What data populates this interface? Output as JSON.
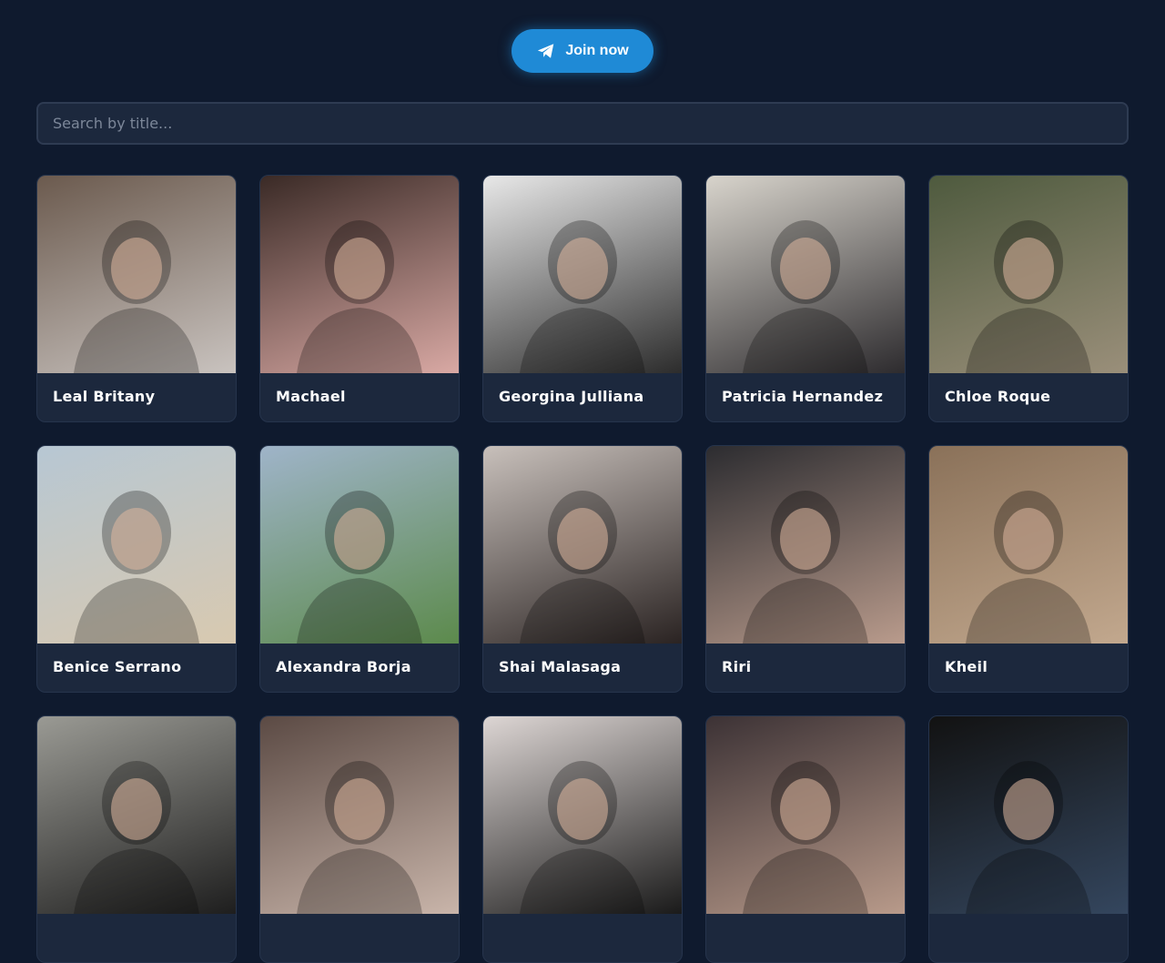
{
  "header": {
    "join_label": "Join now",
    "join_icon": "telegram-paper-plane-icon",
    "accent_color": "#1f8ad6"
  },
  "search": {
    "placeholder": "Search by title...",
    "value": ""
  },
  "cards": [
    {
      "title": "Leal Britany",
      "bg": "#6b5a4e",
      "bg2": "#c9c3bf"
    },
    {
      "title": "Machael",
      "bg": "#3a2a26",
      "bg2": "#d9a9a4"
    },
    {
      "title": "Georgina Julliana",
      "bg": "#e8e8e8",
      "bg2": "#2c2c2c"
    },
    {
      "title": "Patricia Hernandez",
      "bg": "#d8d4cc",
      "bg2": "#2d2b2e"
    },
    {
      "title": "Chloe Roque",
      "bg": "#4e5a3e",
      "bg2": "#9a8f7a"
    },
    {
      "title": "Benice Serrano",
      "bg": "#b7c7d3",
      "bg2": "#d8c9b0"
    },
    {
      "title": "Alexandra Borja",
      "bg": "#9fb4c9",
      "bg2": "#5c8a4c"
    },
    {
      "title": "Shai Malasaga",
      "bg": "#c8c0bb",
      "bg2": "#2a2322"
    },
    {
      "title": "Riri",
      "bg": "#2c2c30",
      "bg2": "#b99b8c"
    },
    {
      "title": "Kheil",
      "bg": "#8a7159",
      "bg2": "#c2a88e"
    },
    {
      "title": "",
      "bg": "#9a9a94",
      "bg2": "#1e1e1e"
    },
    {
      "title": "",
      "bg": "#5b4a44",
      "bg2": "#c9b5aa"
    },
    {
      "title": "",
      "bg": "#ddd6d4",
      "bg2": "#1a1a1a"
    },
    {
      "title": "",
      "bg": "#3c3235",
      "bg2": "#b89a8a"
    },
    {
      "title": "",
      "bg": "#121212",
      "bg2": "#34465e"
    }
  ]
}
